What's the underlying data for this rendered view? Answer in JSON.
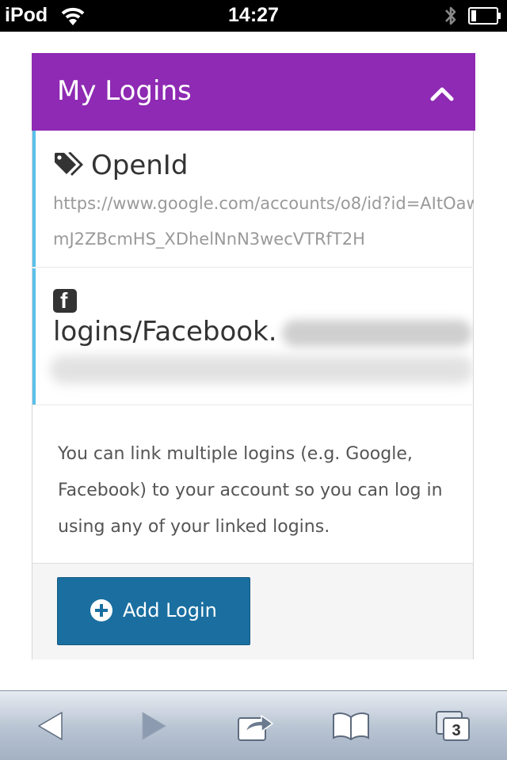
{
  "status_bar": {
    "carrier": "iPod",
    "time": "14:27"
  },
  "panel": {
    "title": "My Logins"
  },
  "logins": [
    {
      "provider": "OpenId",
      "icon": "tags-icon",
      "url": "https://www.google.com/accounts/o8/id?id=AItOawmJ2ZBcmHS_XDhelNnN3wecVTRfT2H"
    },
    {
      "provider_prefix": "logins/Facebook.",
      "icon": "facebook-icon"
    }
  ],
  "help_text": "You can link multiple logins (e.g. Google, Facebook) to your account so you can log in using any of your linked logins.",
  "add_button_label": "Add Login",
  "toolbar": {
    "tab_count": "3"
  },
  "colors": {
    "header": "#8e2ab3",
    "accent_border": "#5bc0eb",
    "button": "#1a6fa0"
  }
}
